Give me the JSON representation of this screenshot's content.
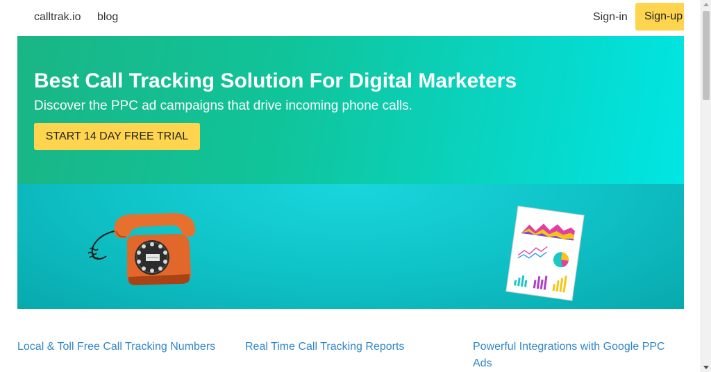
{
  "nav": {
    "brand": "calltrak.io",
    "blog": "blog",
    "signin": "Sign-in",
    "signup": "Sign-up"
  },
  "hero": {
    "title": "Best Call Tracking Solution For Digital Marketers",
    "subtitle": "Discover the PPC ad campaigns that drive incoming phone calls.",
    "cta": "START 14 DAY FREE TRIAL"
  },
  "banner": {
    "left_image": "rotary-phone-icon",
    "right_image": "chart-report-icon"
  },
  "features": [
    {
      "label": "Local & Toll Free Call Tracking Numbers"
    },
    {
      "label": "Real Time Call Tracking Reports"
    },
    {
      "label": "Powerful Integrations with Google PPC Ads"
    }
  ],
  "colors": {
    "accent_button": "#ffd54f",
    "hero_start": "#1ab585",
    "hero_end": "#00e6e4",
    "banner": "#0fc3c8",
    "link": "#2f86c8"
  }
}
